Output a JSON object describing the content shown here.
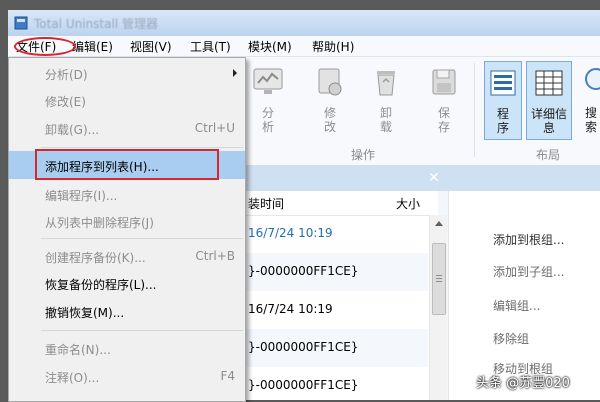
{
  "window": {
    "title": "Total Uninstall 管理器"
  },
  "menubar": {
    "items": [
      {
        "label": "文件(F)"
      },
      {
        "label": "编辑(E)"
      },
      {
        "label": "视图(V)"
      },
      {
        "label": "工具(T)"
      },
      {
        "label": "模块(M)"
      },
      {
        "label": "帮助(H)"
      }
    ]
  },
  "ribbon": {
    "buttons": [
      {
        "label": "分析"
      },
      {
        "label": "修改"
      },
      {
        "label": "卸载"
      },
      {
        "label": "保存"
      },
      {
        "label": "程序"
      },
      {
        "label": "详细信息"
      },
      {
        "label": "搜索"
      }
    ],
    "groups": [
      {
        "label": "操作"
      },
      {
        "label": "布局"
      }
    ]
  },
  "file_menu": {
    "items": [
      {
        "label": "分析(D)",
        "shortcut": ""
      },
      {
        "label": "修改(E)",
        "shortcut": ""
      },
      {
        "label": "卸载(G)...",
        "shortcut": "Ctrl+U"
      },
      {
        "label": "添加程序到列表(H)...",
        "shortcut": ""
      },
      {
        "label": "编辑程序(I)...",
        "shortcut": ""
      },
      {
        "label": "从列表中删除程序(J)",
        "shortcut": ""
      },
      {
        "label": "创建程序备份(K)...",
        "shortcut": "Ctrl+B"
      },
      {
        "label": "恢复备份的程序(L)...",
        "shortcut": ""
      },
      {
        "label": "撤销恢复(M)...",
        "shortcut": ""
      },
      {
        "label": "重命名(N)...",
        "shortcut": ""
      },
      {
        "label": "注释(O)...",
        "shortcut": "F4"
      }
    ]
  },
  "list": {
    "headers": {
      "time": "装时间",
      "size": "大小"
    },
    "rows": [
      {
        "text": "16/7/24 10:19"
      },
      {
        "text": "}-0000000FF1CE}"
      },
      {
        "text": "16/7/24 10:19"
      },
      {
        "text": "}-0000000FF1CE}"
      },
      {
        "text": "}-0000000FF1CE}"
      }
    ]
  },
  "right_panel": {
    "items": [
      {
        "label": "添加到根组..."
      },
      {
        "label": "添加到子组..."
      },
      {
        "label": "编辑组..."
      },
      {
        "label": "移除组"
      },
      {
        "label": "移动到根组"
      }
    ]
  },
  "watermark": "头条 @苏豐020",
  "colors": {
    "highlight": "#a8cdf0",
    "annotation": "#d7262e",
    "ribbon_selected": "#cce4f7"
  }
}
